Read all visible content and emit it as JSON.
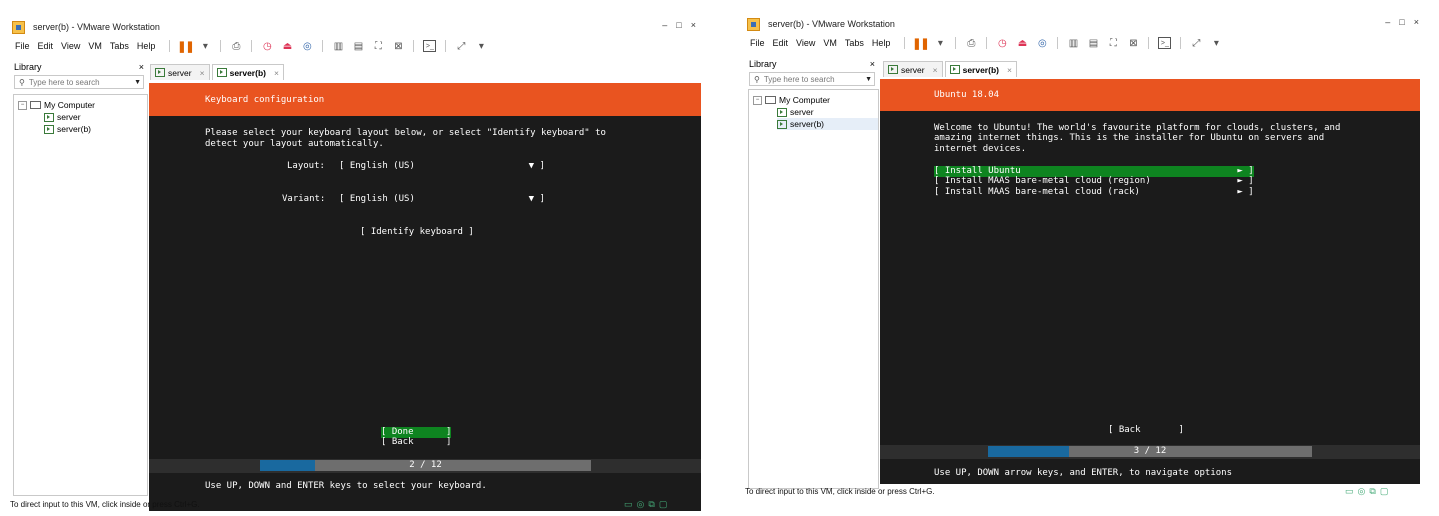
{
  "left": {
    "title": "server(b) - VMware Workstation",
    "menu": [
      "File",
      "Edit",
      "View",
      "VM",
      "Tabs",
      "Help"
    ],
    "library_label": "Library",
    "search_placeholder": "Type here to search",
    "tree": {
      "root": "My Computer",
      "children": [
        "server",
        "server(b)"
      ]
    },
    "tabs": [
      "server",
      "server(b)"
    ],
    "banner_title": "Keyboard configuration",
    "intro_line1": "Please select your keyboard layout below, or select \"Identify keyboard\" to",
    "intro_line2": "detect your layout automatically.",
    "layout_label": "Layout:",
    "layout_value": "[ English (US)                     ▼ ]",
    "variant_label": "Variant:",
    "variant_value": "[ English (US)                     ▼ ]",
    "identify_button": "[ Identify keyboard ]",
    "done_button": "[ Done      ]",
    "back_button": "[ Back      ]",
    "progress_text": "2 / 12",
    "progress_fraction": 0.167,
    "hint": "Use UP, DOWN and ENTER keys to select your keyboard.",
    "status": "To direct input to this VM, click inside or press Ctrl+G."
  },
  "right": {
    "title": "server(b) - VMware Workstation",
    "menu": [
      "File",
      "Edit",
      "View",
      "VM",
      "Tabs",
      "Help"
    ],
    "library_label": "Library",
    "search_placeholder": "Type here to search",
    "tree": {
      "root": "My Computer",
      "children": [
        "server",
        "server(b)"
      ]
    },
    "tabs": [
      "server",
      "server(b)"
    ],
    "banner_title": "Ubuntu 18.04",
    "welcome_line1": "Welcome to Ubuntu! The world's favourite platform for clouds, clusters, and",
    "welcome_line2": "amazing internet things. This is the installer for Ubuntu on servers and",
    "welcome_line3": "internet devices.",
    "options": [
      "[ Install Ubuntu                                        ► ]",
      "[ Install MAAS bare-metal cloud (region)                ► ]",
      "[ Install MAAS bare-metal cloud (rack)                  ► ]"
    ],
    "back_button": "[ Back       ]",
    "progress_text": "3 / 12",
    "progress_fraction": 0.25,
    "hint": "Use UP, DOWN arrow keys, and ENTER, to navigate options",
    "status": "To direct input to this VM, click inside or press Ctrl+G."
  }
}
